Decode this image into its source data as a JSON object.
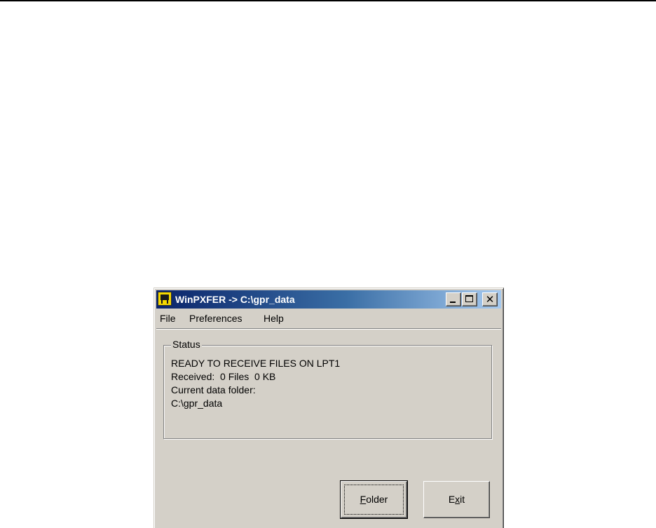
{
  "window": {
    "title": "WinPXFER -> C:\\gpr_data",
    "icon": "printer-icon",
    "caption_buttons": [
      "minimize",
      "maximize",
      "close"
    ]
  },
  "menu": {
    "file": "File",
    "preferences": "Preferences",
    "help": "Help"
  },
  "status": {
    "label": "Status",
    "line1": "READY TO RECEIVE FILES ON LPT1",
    "line2": "Received:  0 Files  0 KB",
    "line3": "Current data folder:",
    "line4": "C:\\gpr_data"
  },
  "buttons": {
    "folder": {
      "mnemonic": "F",
      "rest": "older"
    },
    "exit": {
      "before": "E",
      "mnemonic": "x",
      "after": "it"
    }
  },
  "colors": {
    "titlebar_start": "#0a246a",
    "titlebar_end": "#a6caf0",
    "window_face": "#d4d0c8"
  }
}
